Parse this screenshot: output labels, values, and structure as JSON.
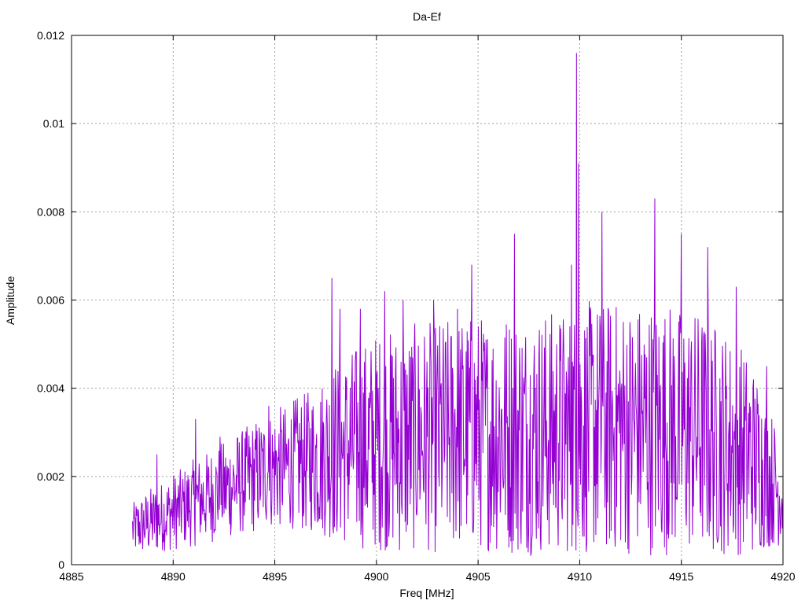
{
  "chart_data": {
    "type": "line",
    "title": "Da-Ef",
    "xlabel": "Freq [MHz]",
    "ylabel": "Amplitude",
    "xlim": [
      4885,
      4920
    ],
    "ylim": [
      0,
      0.012
    ],
    "xticks": [
      4885,
      4890,
      4895,
      4900,
      4905,
      4910,
      4915,
      4920
    ],
    "yticks": [
      0,
      0.002,
      0.004,
      0.006,
      0.008,
      0.01,
      0.012
    ],
    "xtick_labels": [
      "4885",
      "4890",
      "4895",
      "4900",
      "4905",
      "4910",
      "4915",
      "4920"
    ],
    "ytick_labels": [
      "0",
      "0.002",
      "0.004",
      "0.006",
      "0.008",
      "0.01",
      "0.012"
    ],
    "grid": true,
    "series": [
      {
        "color": "#9400d3",
        "x_range": [
          4888.0,
          4920.0
        ],
        "point_count": 1280,
        "envelope": {
          "x": [
            4888.0,
            4888.5,
            4889.0,
            4889.5,
            4890.0,
            4890.5,
            4891.0,
            4891.5,
            4892.0,
            4892.5,
            4893.0,
            4893.5,
            4894.0,
            4894.5,
            4895.0,
            4895.5,
            4896.0,
            4896.5,
            4897.0,
            4897.5,
            4898.0,
            4898.5,
            4899.0,
            4899.5,
            4900.0,
            4900.5,
            4901.0,
            4901.5,
            4902.0,
            4902.5,
            4903.0,
            4903.5,
            4904.0,
            4904.5,
            4905.0,
            4905.5,
            4906.0,
            4906.5,
            4907.0,
            4907.5,
            4908.0,
            4908.5,
            4909.0,
            4909.5,
            4910.0,
            4910.5,
            4911.0,
            4911.5,
            4912.0,
            4912.5,
            4913.0,
            4913.5,
            4914.0,
            4914.5,
            4915.0,
            4915.5,
            4916.0,
            4916.5,
            4917.0,
            4917.5,
            4918.0,
            4918.5,
            4919.0,
            4919.5,
            4920.0
          ],
          "mean": [
            0.0008,
            0.0009,
            0.001,
            0.0011,
            0.0012,
            0.0013,
            0.0014,
            0.0015,
            0.0016,
            0.0017,
            0.0018,
            0.0019,
            0.002,
            0.0021,
            0.0022,
            0.0022,
            0.0023,
            0.0023,
            0.0024,
            0.0025,
            0.0026,
            0.0026,
            0.0027,
            0.0027,
            0.0028,
            0.0028,
            0.0028,
            0.0028,
            0.0029,
            0.0029,
            0.0029,
            0.0029,
            0.003,
            0.003,
            0.003,
            0.003,
            0.003,
            0.003,
            0.003,
            0.003,
            0.003,
            0.003,
            0.003,
            0.003,
            0.0031,
            0.0031,
            0.0031,
            0.0031,
            0.0031,
            0.0031,
            0.0031,
            0.0031,
            0.0031,
            0.0031,
            0.003,
            0.003,
            0.003,
            0.0029,
            0.0028,
            0.0027,
            0.0026,
            0.0024,
            0.0022,
            0.0019,
            0.0015
          ],
          "spread": [
            0.0006,
            0.0007,
            0.0008,
            0.0008,
            0.0009,
            0.0009,
            0.001,
            0.001,
            0.0011,
            0.0011,
            0.0012,
            0.0012,
            0.0013,
            0.0013,
            0.0014,
            0.0014,
            0.0015,
            0.0016,
            0.0017,
            0.0019,
            0.0021,
            0.0022,
            0.0023,
            0.0024,
            0.0025,
            0.0025,
            0.0026,
            0.0026,
            0.0026,
            0.0026,
            0.0027,
            0.0027,
            0.0027,
            0.0027,
            0.0027,
            0.0027,
            0.0028,
            0.0028,
            0.0028,
            0.0028,
            0.0028,
            0.0028,
            0.0028,
            0.0028,
            0.0029,
            0.0029,
            0.0029,
            0.0029,
            0.0029,
            0.0029,
            0.0029,
            0.0029,
            0.0029,
            0.0029,
            0.0028,
            0.0028,
            0.0028,
            0.0027,
            0.0026,
            0.0025,
            0.0024,
            0.0022,
            0.0019,
            0.0015,
            0.0011
          ]
        },
        "peaks": [
          {
            "x": 4889.2,
            "y": 0.0025
          },
          {
            "x": 4891.1,
            "y": 0.0033
          },
          {
            "x": 4892.3,
            "y": 0.0029
          },
          {
            "x": 4894.7,
            "y": 0.0036
          },
          {
            "x": 4897.8,
            "y": 0.0065
          },
          {
            "x": 4898.2,
            "y": 0.0058
          },
          {
            "x": 4899.2,
            "y": 0.0058
          },
          {
            "x": 4900.4,
            "y": 0.0062
          },
          {
            "x": 4901.3,
            "y": 0.006
          },
          {
            "x": 4902.8,
            "y": 0.006
          },
          {
            "x": 4904.0,
            "y": 0.0058
          },
          {
            "x": 4904.7,
            "y": 0.0068
          },
          {
            "x": 4906.8,
            "y": 0.0075
          },
          {
            "x": 4909.6,
            "y": 0.0068
          },
          {
            "x": 4909.85,
            "y": 0.0116
          },
          {
            "x": 4909.95,
            "y": 0.0091
          },
          {
            "x": 4911.1,
            "y": 0.008
          },
          {
            "x": 4913.7,
            "y": 0.0083
          },
          {
            "x": 4915.0,
            "y": 0.0075
          },
          {
            "x": 4916.3,
            "y": 0.0072
          },
          {
            "x": 4917.7,
            "y": 0.0063
          },
          {
            "x": 4919.2,
            "y": 0.0045
          }
        ]
      }
    ]
  }
}
